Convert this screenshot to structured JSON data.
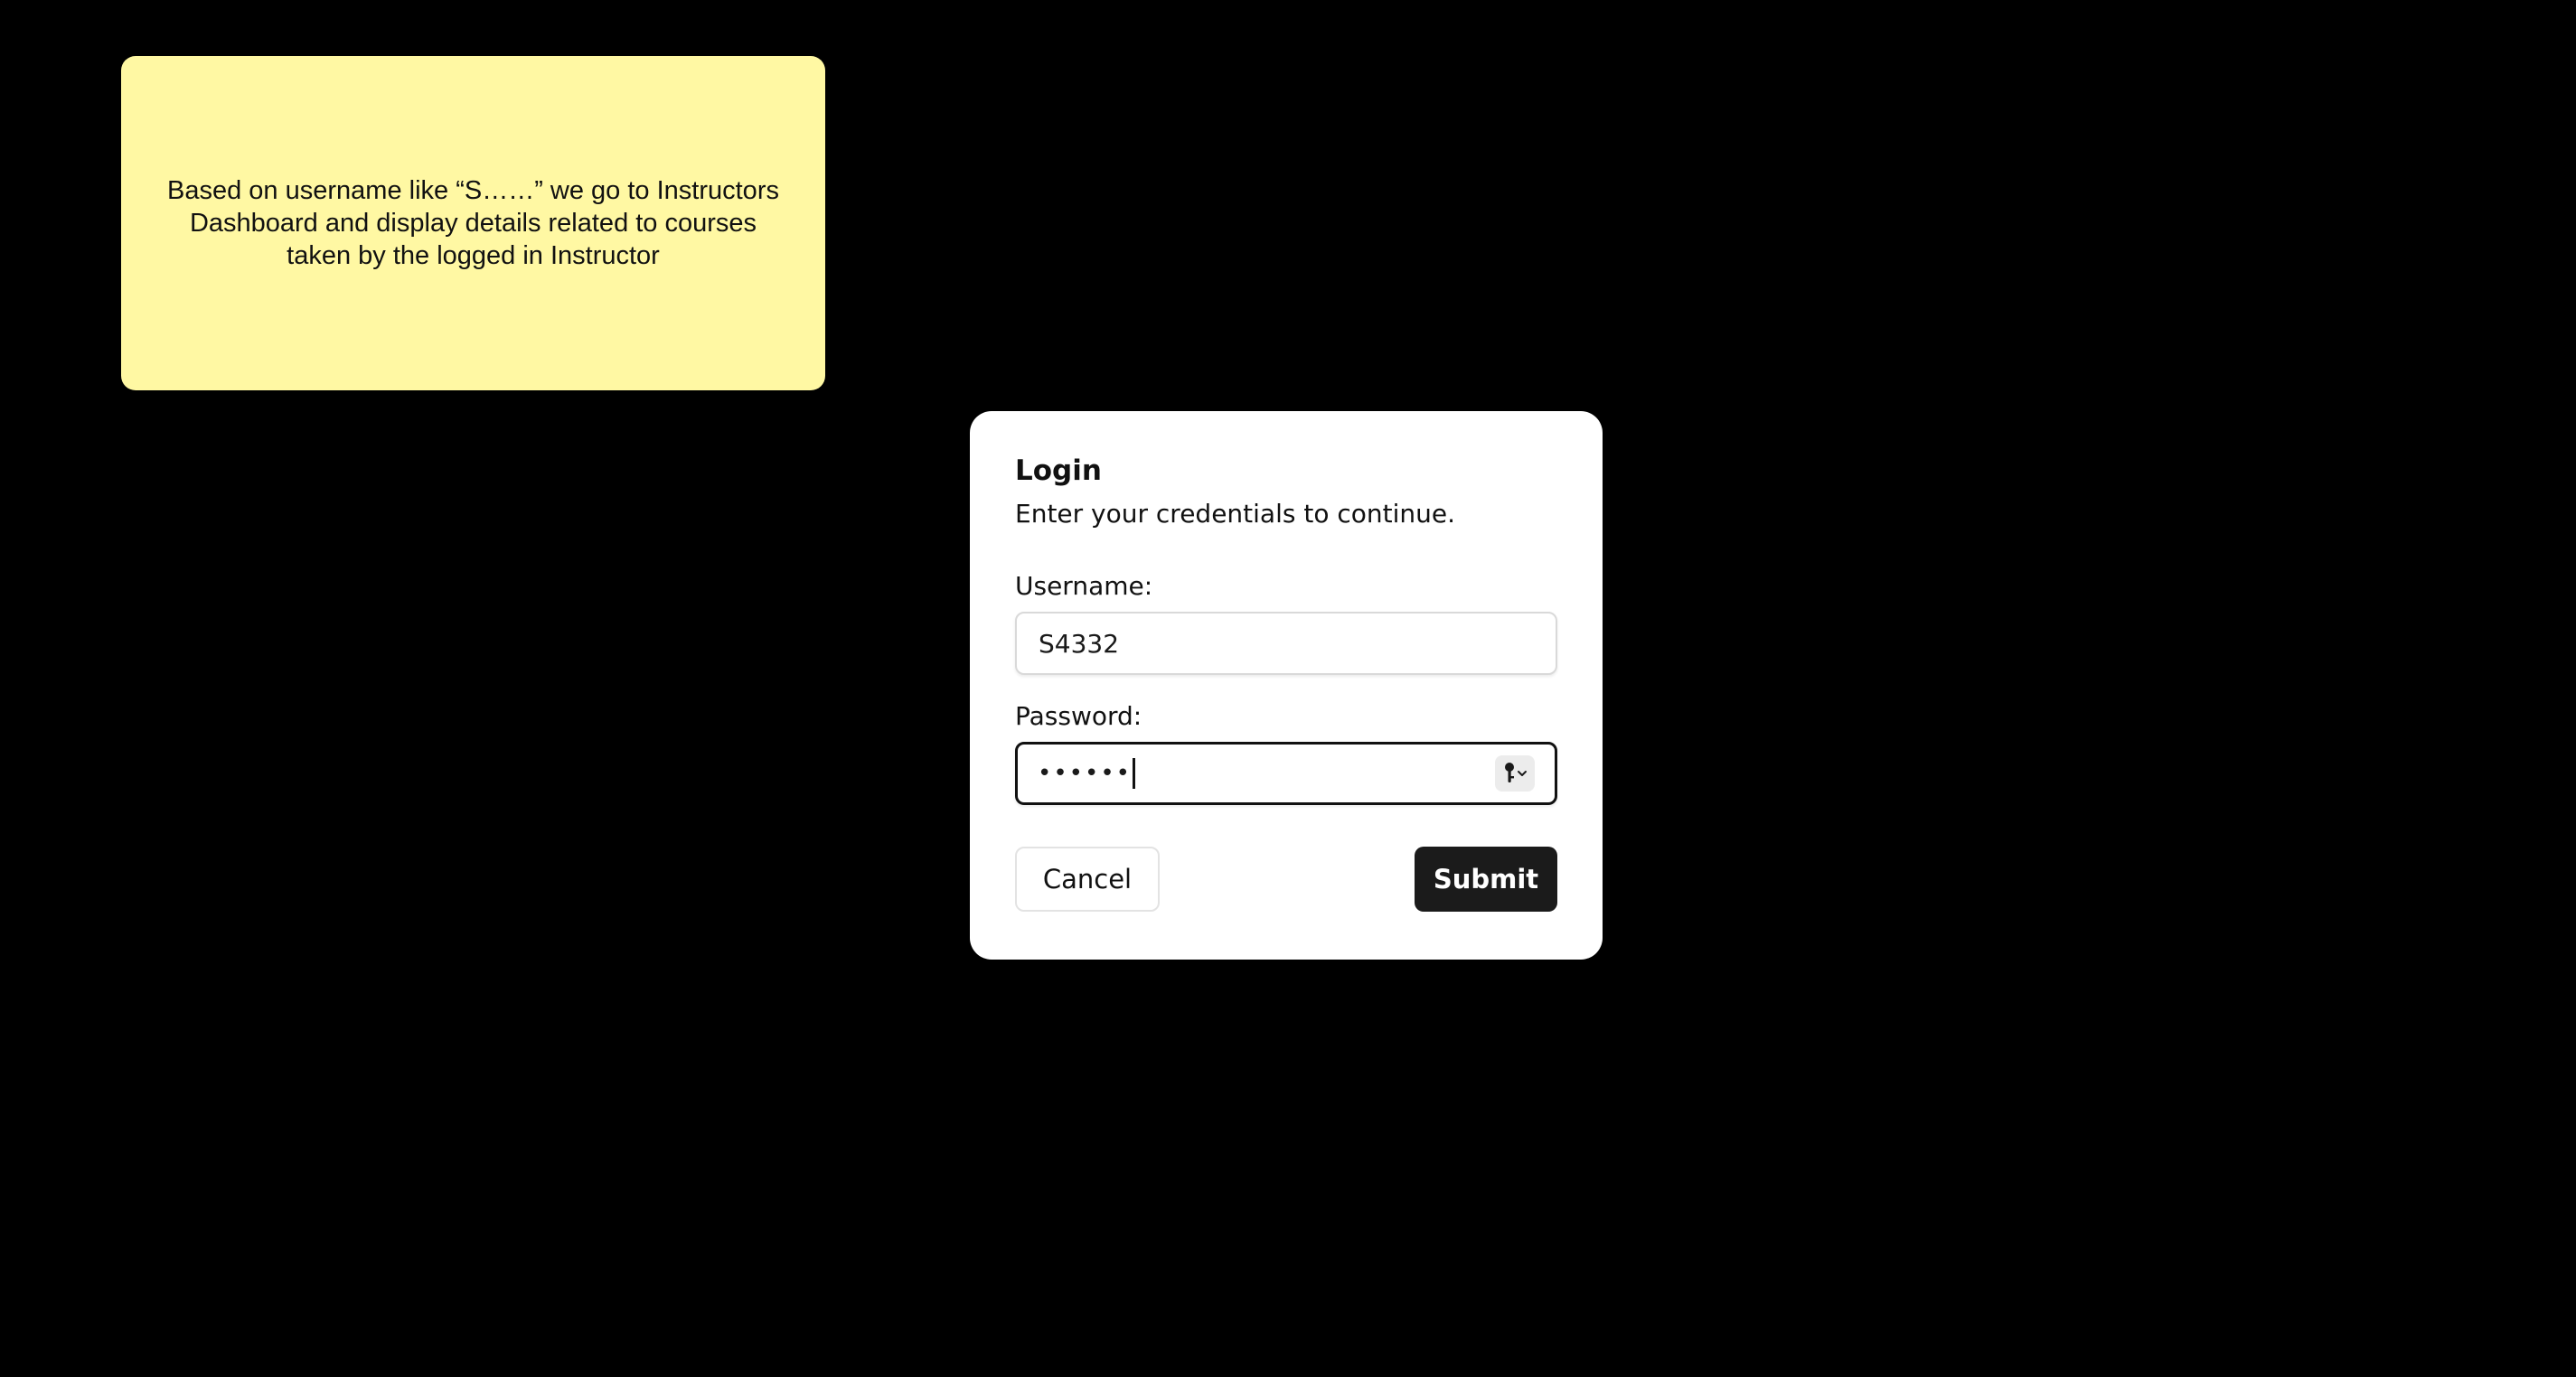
{
  "sticky_note": {
    "text": "Based on username like “S……” we go to Instructors Dashboard and display details related to courses taken by the logged in Instructor"
  },
  "login_dialog": {
    "title": "Login",
    "subtitle": "Enter your credentials to continue.",
    "username_label": "Username:",
    "username_value": "S4332",
    "password_label": "Password:",
    "password_masked": "••••••",
    "cancel_label": "Cancel",
    "submit_label": "Submit",
    "password_manager_icon": "key-icon"
  },
  "colors": {
    "background": "#000000",
    "sticky_note": "#fff8a3",
    "submit_button": "#1b1b1b",
    "dialog": "#ffffff"
  }
}
